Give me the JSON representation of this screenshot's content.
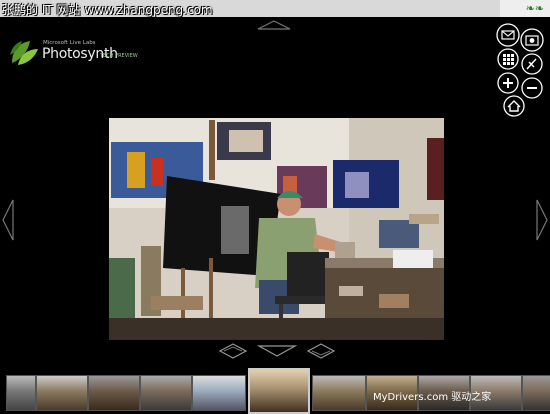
{
  "watermark": {
    "text": "张鹏的 IT 网站 www.zhangpeng.com"
  },
  "brand": {
    "small": "Microsoft Live Labs",
    "name": "Photosynth",
    "tag": "TECH PREVIEW"
  },
  "credit": {
    "site": "MyDrivers.com",
    "cn": "驱动之家"
  },
  "icons": [
    "leaf-logo-icon",
    "email-icon",
    "camera-icon",
    "grid-icon",
    "satellite-icon",
    "zoom-in-icon",
    "zoom-out-icon",
    "home-icon"
  ],
  "thumbnails": [
    {
      "colors": [
        "#777",
        "#444",
        "#bbb"
      ]
    },
    {
      "colors": [
        "#8a7a60",
        "#4a3a2a",
        "#ccc"
      ]
    },
    {
      "colors": [
        "#6a5a4a",
        "#3a2a1a",
        "#999"
      ]
    },
    {
      "colors": [
        "#7a6a5a",
        "#3a3a3a",
        "#aaa"
      ]
    },
    {
      "colors": [
        "#9ab",
        "#556",
        "#ddd"
      ]
    },
    {
      "colors": [
        "#a89070",
        "#403020",
        "#e0d0b0"
      ],
      "selected": true
    },
    {
      "colors": [
        "#8a7a5a",
        "#4a3a2a",
        "#bbb"
      ]
    },
    {
      "colors": [
        "#7a6a4a",
        "#3a2a1a",
        "#c0b090"
      ]
    },
    {
      "colors": [
        "#6a5a4a",
        "#2a2a2a",
        "#aaa"
      ]
    },
    {
      "colors": [
        "#8a7a6a",
        "#3a3a3a",
        "#bbb"
      ]
    },
    {
      "colors": [
        "#7a6a5a",
        "#333",
        "#999"
      ]
    }
  ]
}
